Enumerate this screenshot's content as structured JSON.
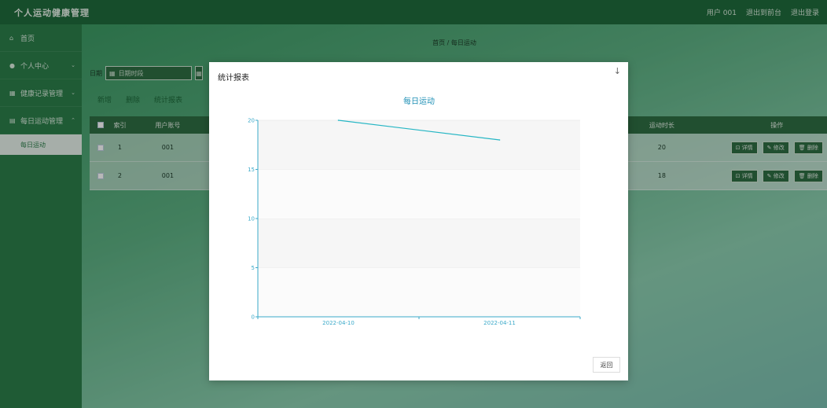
{
  "app": {
    "title": "个人运动健康管理"
  },
  "header": {
    "user": "用户 001",
    "back_to_console": "退出到前台",
    "logout": "退出登录"
  },
  "sidebar": {
    "items": [
      {
        "label": "首页",
        "icon": "home-icon",
        "has_chevron": false
      },
      {
        "label": "个人中心",
        "icon": "user-icon",
        "has_chevron": true
      },
      {
        "label": "健康记录管理",
        "icon": "grid-icon",
        "has_chevron": true
      },
      {
        "label": "每日运动管理",
        "icon": "list-icon",
        "has_chevron": true
      }
    ],
    "sub_item": "每日运动"
  },
  "breadcrumb": {
    "home": "首页",
    "sep": "/",
    "current": "每日运动"
  },
  "search": {
    "label": "日期",
    "placeholder": "日期时段"
  },
  "actions": {
    "add": "新增",
    "delete": "删除",
    "report": "统计报表"
  },
  "table": {
    "headers": {
      "index": "索引",
      "user": "用户账号",
      "duration": "运动时长",
      "ops": "操作"
    },
    "rows": [
      {
        "index": "1",
        "user": "001",
        "duration": "20"
      },
      {
        "index": "2",
        "user": "001",
        "duration": "18"
      }
    ],
    "op_labels": {
      "detail": "详情",
      "edit": "修改",
      "remove": "删除"
    }
  },
  "modal": {
    "title": "统计报表",
    "close_symbol": "↓",
    "return_label": "返回"
  },
  "colors": {
    "line": "#26b6c4",
    "axis": "#3aa9c9",
    "title": "#1d8fb5"
  },
  "chart_data": {
    "type": "line",
    "title": "每日运动",
    "categories": [
      "2022-04-10",
      "2022-04-11"
    ],
    "series": [
      {
        "values": [
          20,
          18
        ]
      }
    ],
    "ylim": [
      0,
      20
    ],
    "yticks": [
      "0",
      "5",
      "10",
      "15",
      "20"
    ],
    "grid": true
  }
}
